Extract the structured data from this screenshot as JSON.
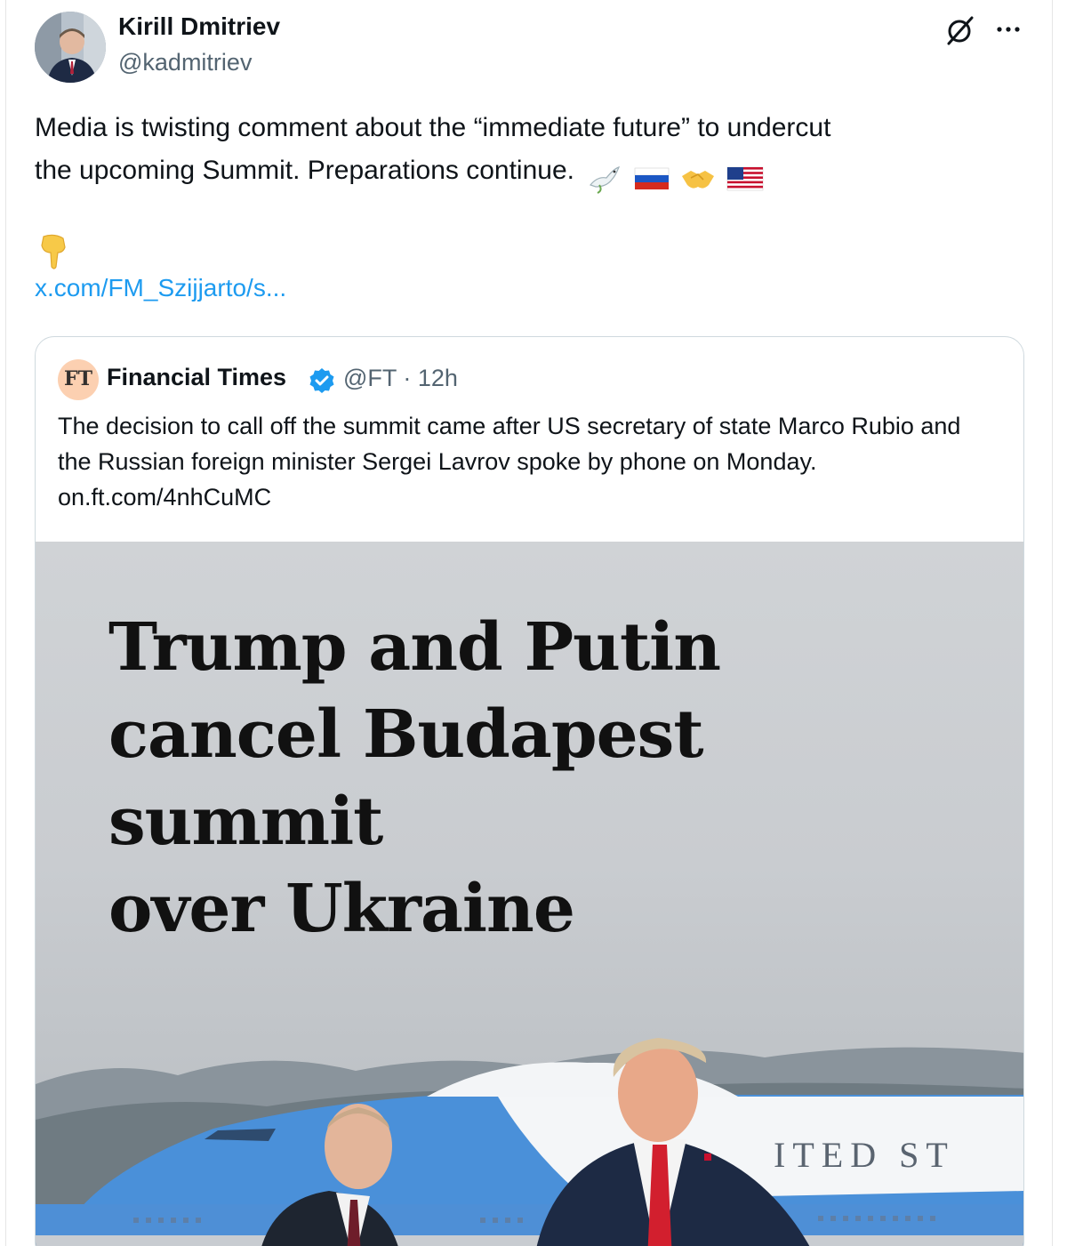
{
  "author": {
    "name": "Kirill Dmitriev",
    "handle": "@kadmitriev",
    "avatar_icon": "person-photo-avatar"
  },
  "actions": {
    "grok_icon": "grok-icon",
    "more_icon": "more-horizontal-icon"
  },
  "post": {
    "text_line1": "Media is twisting comment about the “immediate future” to undercut",
    "text_line2": "the upcoming Summit. Preparations continue.",
    "emojis": [
      "dove-icon",
      "russia-flag-icon",
      "handshake-icon",
      "us-flag-icon"
    ],
    "pointer_emoji": "point-down-icon",
    "link": "x.com/FM_Szijjarto/s..."
  },
  "quote": {
    "avatar_text": "FT",
    "name": "Financial Times",
    "verified_icon": "verified-badge-icon",
    "meta": "@FT · 12h",
    "text": "The decision to call off the summit came after US secretary of state Marco Rubio and the Russian foreign minister Sergei Lavrov spoke by phone on Monday. on.ft.com/4nhCuMC",
    "image": {
      "headline_line1": "Trump and Putin",
      "headline_line2": "cancel Budapest summit",
      "headline_line3": "over Ukraine",
      "plane_text": "ITED ST"
    }
  },
  "colors": {
    "link": "#1d9bf0",
    "secondary_text": "#536471",
    "verified": "#1d9bf0",
    "ft_pink": "#fcd0b1",
    "plane_blue": "#4a90d9"
  }
}
